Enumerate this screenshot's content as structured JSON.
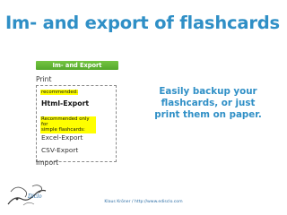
{
  "slide": {
    "title": "Im- and export of flashcards",
    "callout_lines": [
      "Easily backup your",
      "flashcards, or just",
      "print them on paper."
    ],
    "footer": "Klaus Kröner / http://www.edisclo.com"
  },
  "menu": {
    "header": "Im- and Export",
    "print": "Print",
    "recommended_tag": "recommended:",
    "html_export": "Html-Export",
    "simple_tag_lines": [
      "Recommended only for",
      "simple flashcards:"
    ],
    "excel_export": "Excel-Export",
    "csv_export": "CSV-Export",
    "import": "Import"
  },
  "colors": {
    "title": "#2f8fc6",
    "menu_header": "#5db531",
    "highlight": "#ffff00"
  },
  "logo": {
    "icon": "flashcard-logo-icon",
    "lettering": "Diclo"
  }
}
